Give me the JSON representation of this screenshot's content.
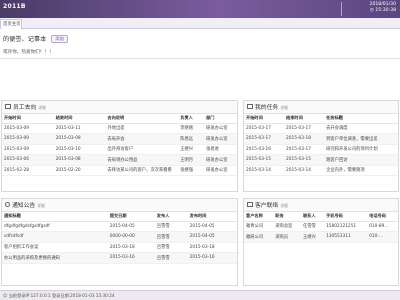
{
  "header": {
    "brand": "2011B",
    "date": "2018/01/30",
    "time": "15:30:38"
  },
  "tabs": [
    {
      "label": "首页主页"
    }
  ],
  "welcome": {
    "title": "的便签、记事本",
    "button": "添加",
    "subtitle": "或许你，热爱你们！！！"
  },
  "staff_panel": {
    "title": "员工去向",
    "more": "详细",
    "headers": [
      "开始时间",
      "结束时间",
      "去向说明",
      "负责人",
      "部门"
    ],
    "rows": [
      [
        "2015-03-09",
        "2015-03-11",
        "外地出差",
        "李继刚",
        "研发办公室"
      ],
      [
        "2015-03-09",
        "2015-03-09",
        "去局开会",
        "陈易远",
        "研发办公室"
      ],
      [
        "2015-03-09",
        "2015-03-10",
        "出外拜访客户",
        "王继兴",
        "张易进"
      ],
      [
        "2015-03-06",
        "2015-03-08",
        "去局领办公用品",
        "王明月",
        "研发办公室"
      ],
      [
        "2015-02-28",
        "2015-02-20",
        "去拜访某公司的客户，次次来看看",
        "张继强",
        "研发办公室"
      ]
    ]
  },
  "task_panel": {
    "title": "我的任务",
    "more": "详细",
    "headers": [
      "开始时间",
      "结束时间",
      "任务标题"
    ],
    "rows": [
      [
        "2015-03-17",
        "2015-03-17",
        "去开会调度"
      ],
      [
        "2015-03-17",
        "2015-03-18",
        "到客户单位调查，需要出差"
      ],
      [
        "2015-03-16",
        "2015-03-17",
        "研究和开发公司的项目计划"
      ],
      [
        "2015-03-15",
        "2015-03-15",
        "跑客户回访"
      ],
      [
        "2015-03-14",
        "2015-03-14",
        "企业内外，需要跑项"
      ]
    ]
  },
  "notice_panel": {
    "title": "通知公告",
    "more": "详细",
    "headers": [
      "通知标题",
      "提交日期",
      "发布人",
      "发布时间"
    ],
    "rows": [
      [
        "dfgdfgdfgdsfgsdfgsdf",
        "2015-04-05",
        "吕雪雪",
        "2015-04-05"
      ],
      [
        "sdfsdfsdf",
        "0000-00-00",
        "吕雪雪",
        "2015-04-05"
      ],
      [
        "客户组织工作会议",
        "2015-03-18",
        "吕雪雪",
        "2015-03-18"
      ],
      [
        "办公用品的采购及更换的通知",
        "2015-03-16",
        "吕雪雪",
        "2015-03-16"
      ]
    ]
  },
  "client_panel": {
    "title": "客户联络",
    "more": "详细",
    "headers": [
      "客户名称",
      "职务",
      "联系人",
      "手机号码",
      "电话号码"
    ],
    "rows": [
      [
        "雅青公司",
        "采购总监",
        "任雪雪",
        "15802121251",
        "010-89..."
      ],
      [
        "雅研公司",
        "采购员",
        "王继兴",
        "130553311",
        "010-..."
      ]
    ]
  },
  "statusbar": {
    "text": "当前登录IP:127.0.0.1 登录日期:2018-01-03 15:30:24"
  }
}
